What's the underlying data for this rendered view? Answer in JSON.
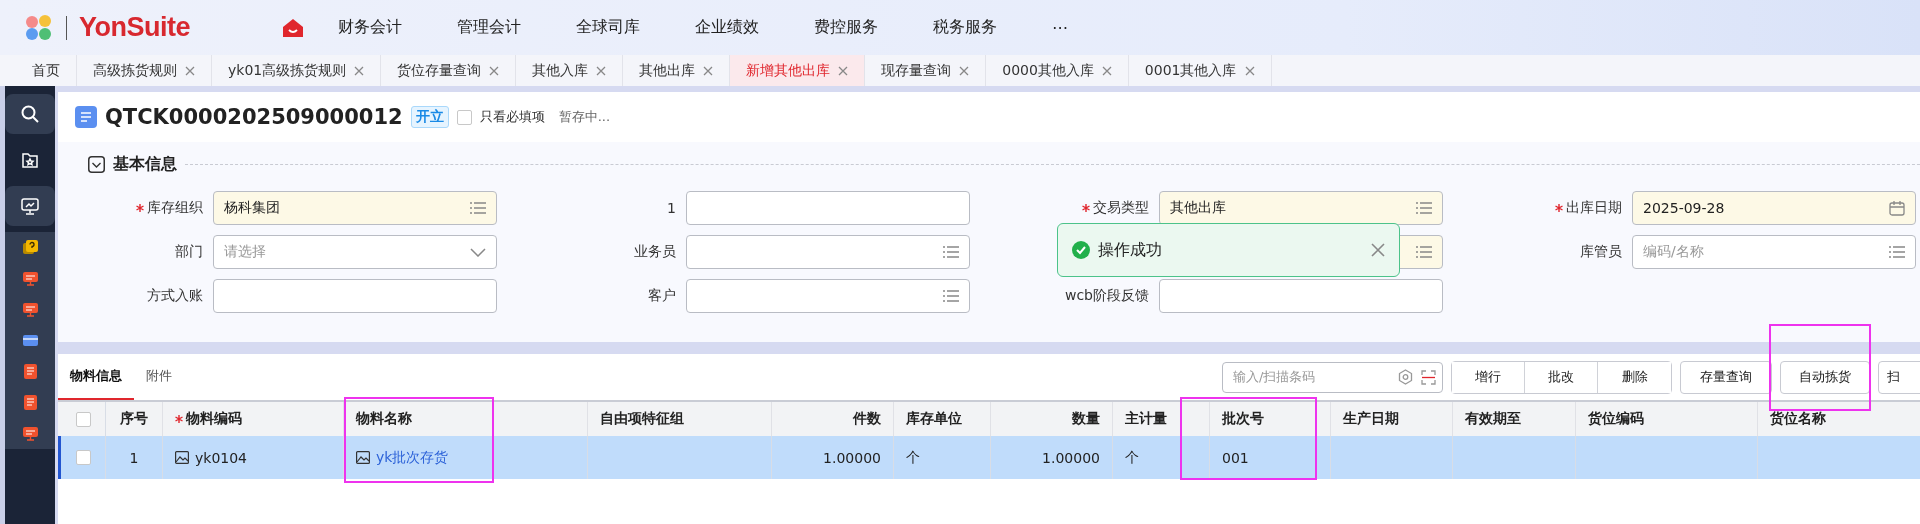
{
  "header": {
    "brand": "YonSuite",
    "nav": [
      "财务会计",
      "管理会计",
      "全球司库",
      "企业绩效",
      "费控服务",
      "税务服务"
    ],
    "more": "⋯"
  },
  "tabs": [
    {
      "label": "首页",
      "selected": false,
      "closable": false
    },
    {
      "label": "高级拣货规则",
      "selected": false,
      "closable": true
    },
    {
      "label": "yk01高级拣货规则",
      "selected": false,
      "closable": true
    },
    {
      "label": "货位存量查询",
      "selected": false,
      "closable": true
    },
    {
      "label": "其他入库",
      "selected": false,
      "closable": true
    },
    {
      "label": "其他出库",
      "selected": false,
      "closable": true
    },
    {
      "label": "新增其他出库",
      "selected": true,
      "closable": true
    },
    {
      "label": "现存量查询",
      "selected": false,
      "closable": true
    },
    {
      "label": "0000其他入库",
      "selected": false,
      "closable": true
    },
    {
      "label": "0001其他入库",
      "selected": false,
      "closable": true
    }
  ],
  "sidebar": {
    "items": [
      {
        "kind": "search"
      },
      {
        "kind": "favorites"
      },
      {
        "kind": "monitor"
      },
      {
        "kind": "help"
      },
      {
        "kind": "app-red"
      },
      {
        "kind": "app-red"
      },
      {
        "kind": "card-blue"
      },
      {
        "kind": "doc-red"
      },
      {
        "kind": "doc-red"
      },
      {
        "kind": "app-red"
      }
    ]
  },
  "document": {
    "code": "QTCK0000202509000012",
    "status": "开立",
    "required_only": {
      "label": "只看必填项",
      "checked": false
    },
    "save_state": "暂存中..."
  },
  "section": {
    "title": "基本信息",
    "expanded": true
  },
  "fields": [
    {
      "label": "库存组织",
      "required": true,
      "kind": "lookup",
      "value": "杨科集团"
    },
    {
      "label": "1",
      "required": false,
      "kind": "text"
    },
    {
      "label": "交易类型",
      "required": true,
      "kind": "lookup",
      "value": "其他出库"
    },
    {
      "label": "出库日期",
      "required": true,
      "kind": "date",
      "value": "2025-09-28"
    },
    {
      "label": "部门",
      "required": false,
      "kind": "select",
      "placeholder": "请选择"
    },
    {
      "label": "业务员",
      "required": false,
      "kind": "lookup"
    },
    {
      "required": true,
      "kind": "lookup"
    },
    {
      "label": "库管员",
      "required": false,
      "kind": "lookup",
      "placeholder": "编码/名称"
    },
    {
      "label": "方式入账",
      "required": false,
      "kind": "text"
    },
    {
      "label": "客户",
      "required": false,
      "kind": "lookup"
    },
    {
      "label": "wcb阶段反馈",
      "required": false,
      "kind": "text"
    }
  ],
  "toast": {
    "message": "操作成功"
  },
  "detail_tabs": [
    {
      "label": "物料信息",
      "selected": true
    },
    {
      "label": "附件",
      "selected": false
    }
  ],
  "toolbar": {
    "barcode": {
      "placeholder": "输入/扫描条码"
    },
    "button_group": [
      "增行",
      "批改",
      "删除"
    ],
    "buttons": [
      "存量查询",
      "自动拣货",
      "扫"
    ]
  },
  "table": {
    "all_checked": false,
    "columns": [
      {
        "label": "序号",
        "required": false
      },
      {
        "label": "物料编码",
        "required": true
      },
      {
        "label": "物料名称",
        "required": false
      },
      {
        "label": "自由项特征组",
        "required": false
      },
      {
        "label": "件数",
        "required": false
      },
      {
        "label": "库存单位",
        "required": false
      },
      {
        "label": "数量",
        "required": false
      },
      {
        "label": "主计量",
        "required": false
      },
      {
        "label": "批次号",
        "required": false
      },
      {
        "label": "生产日期",
        "required": false
      },
      {
        "label": "有效期至",
        "required": false
      },
      {
        "label": "货位编码",
        "required": false
      },
      {
        "label": "货位名称",
        "required": false
      }
    ],
    "rows": [
      {
        "selected": true,
        "checked": false,
        "cells": [
          {
            "kind": "text",
            "text": "1"
          },
          {
            "kind": "image",
            "text": "yk0104"
          },
          {
            "kind": "image-link",
            "text": "yk批次存货"
          },
          {
            "kind": "text",
            "text": ""
          },
          {
            "kind": "text",
            "text": "1.00000"
          },
          {
            "kind": "text",
            "text": "个"
          },
          {
            "kind": "text",
            "text": "1.00000"
          },
          {
            "kind": "text",
            "text": "个"
          },
          {
            "kind": "text",
            "text": "001"
          },
          {
            "kind": "text",
            "text": ""
          },
          {
            "kind": "text",
            "text": ""
          },
          {
            "kind": "text",
            "text": ""
          },
          {
            "kind": "text",
            "text": ""
          }
        ]
      }
    ]
  }
}
